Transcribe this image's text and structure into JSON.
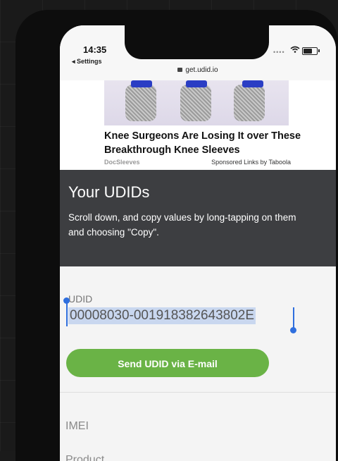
{
  "status_bar": {
    "time": "14:35",
    "back_label": "◂ Settings",
    "url": "get.udid.io"
  },
  "ad": {
    "title": "Knee Surgeons Are Losing It over These Breakthrough Knee Sleeves",
    "brand": "DocSleeves",
    "sponsor": "Sponsored Links by Taboola"
  },
  "header": {
    "title": "Your UDIDs",
    "description": "Scroll down, and copy values by long-tapping on them and choosing \"Copy\"."
  },
  "fields": {
    "udid_label": "UDID",
    "udid_value": "00008030-001918382643802E",
    "imei_label": "IMEI",
    "product_label": "Product"
  },
  "actions": {
    "send_label": "Send UDID via E-mail"
  },
  "colors": {
    "accent_green": "#6ab346",
    "selection_blue": "#2f6fde",
    "dark_section": "#3d3e41"
  }
}
